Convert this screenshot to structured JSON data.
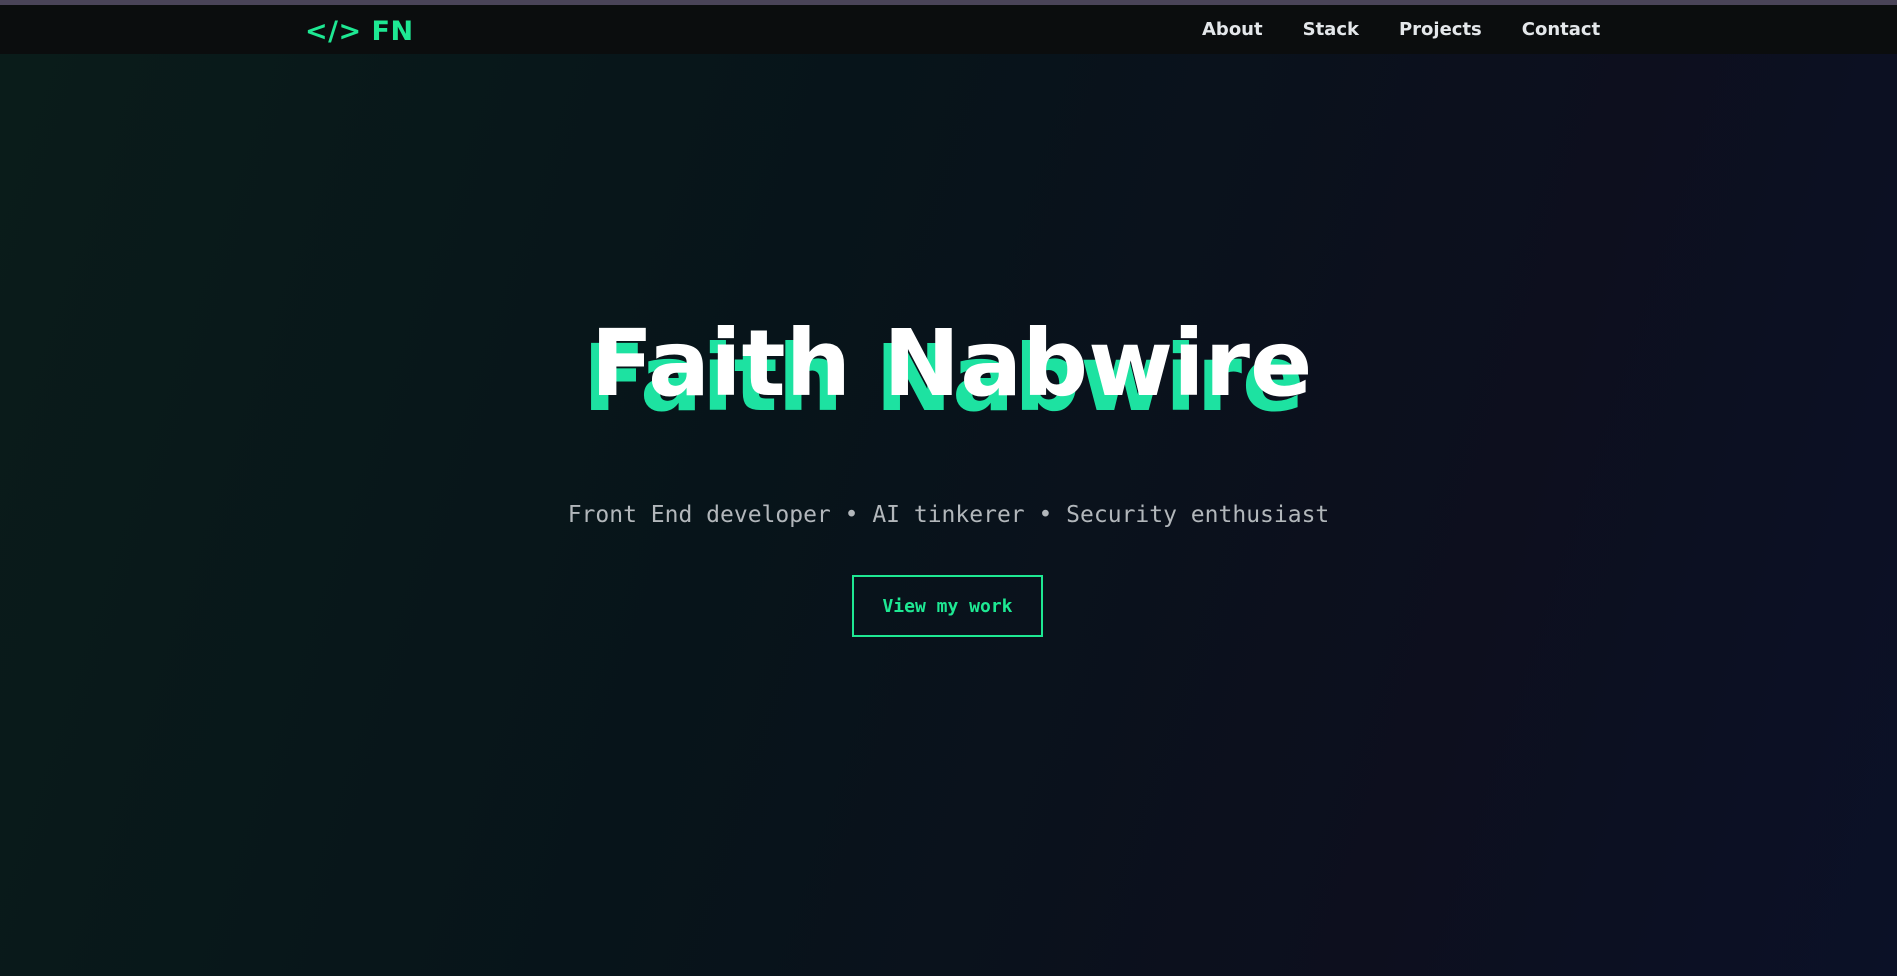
{
  "nav": {
    "logo": "</> FN",
    "links": [
      "About",
      "Stack",
      "Projects",
      "Contact"
    ]
  },
  "hero": {
    "name": "Faith Nabwire",
    "tagline": "Front End developer • AI tinkerer • Security enthusiast",
    "cta_label": "View my work"
  },
  "colors": {
    "accent": "#1ee893",
    "background": "#07131a",
    "navbar": "#0b0d0e"
  }
}
